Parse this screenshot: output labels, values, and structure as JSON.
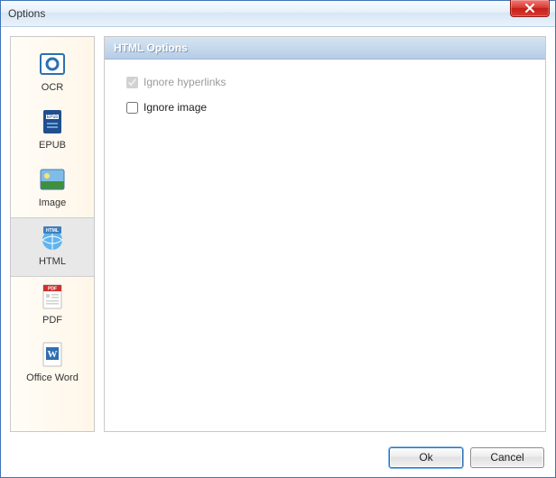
{
  "window": {
    "title": "Options"
  },
  "sidebar": {
    "items": [
      {
        "label": "OCR"
      },
      {
        "label": "EPUB"
      },
      {
        "label": "Image"
      },
      {
        "label": "HTML"
      },
      {
        "label": "PDF"
      },
      {
        "label": "Office Word"
      }
    ],
    "selected_index": 3
  },
  "panel": {
    "title": "HTML Options",
    "options": [
      {
        "label": "Ignore hyperlinks",
        "checked": true,
        "disabled": true
      },
      {
        "label": "Ignore image",
        "checked": false,
        "disabled": false
      }
    ]
  },
  "footer": {
    "ok_label": "Ok",
    "cancel_label": "Cancel"
  },
  "colors": {
    "titlebar_border": "#3f74b8",
    "close_red": "#d83a32",
    "panel_header_from": "#d6e4f2",
    "panel_header_to": "#b6cde6",
    "sidebar_bg_from": "#fffdf7",
    "sidebar_bg_to": "#fff6e9"
  }
}
